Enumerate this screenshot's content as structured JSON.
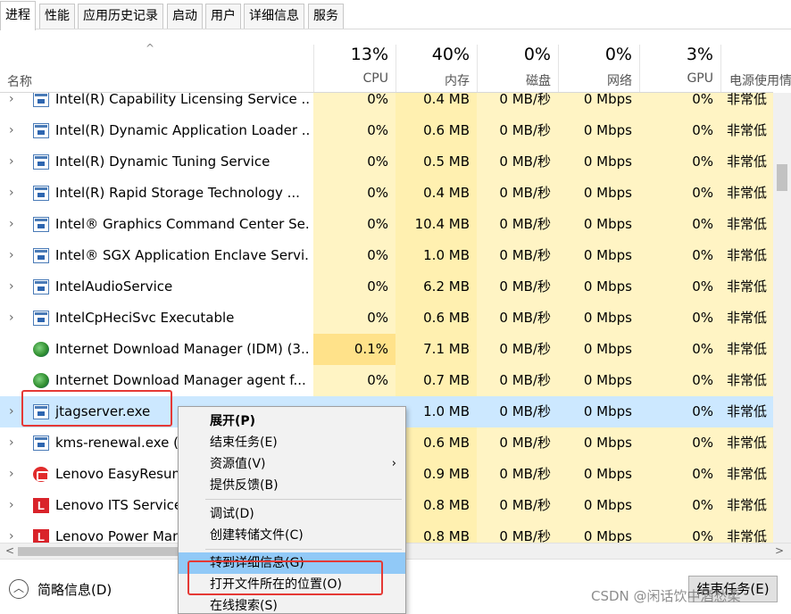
{
  "tabs": [
    {
      "label": "进程",
      "active": true
    },
    {
      "label": "性能",
      "active": false
    },
    {
      "label": "应用历史记录",
      "active": false
    },
    {
      "label": "启动",
      "active": false
    },
    {
      "label": "用户",
      "active": false
    },
    {
      "label": "详细信息",
      "active": false
    },
    {
      "label": "服务",
      "active": false
    }
  ],
  "header": {
    "sort_glyph": "^",
    "name_label": "名称",
    "cpu": {
      "pct": "13%",
      "label": "CPU"
    },
    "mem": {
      "pct": "40%",
      "label": "内存"
    },
    "disk": {
      "pct": "0%",
      "label": "磁盘"
    },
    "net": {
      "pct": "0%",
      "label": "网络"
    },
    "gpu": {
      "pct": "3%",
      "label": "GPU"
    },
    "power_label": "电源使用情"
  },
  "rows": [
    {
      "name": "Intel(R) Capability Licensing Service ...",
      "cpu": "0%",
      "mem": "0.4 MB",
      "disk": "0 MB/秒",
      "net": "0 Mbps",
      "gpu": "0%",
      "power": "非常低",
      "icon": "service-icon",
      "expandable": true
    },
    {
      "name": "Intel(R) Dynamic Application Loader ...",
      "cpu": "0%",
      "mem": "0.6 MB",
      "disk": "0 MB/秒",
      "net": "0 Mbps",
      "gpu": "0%",
      "power": "非常低",
      "icon": "service-icon",
      "expandable": true
    },
    {
      "name": "Intel(R) Dynamic Tuning Service",
      "cpu": "0%",
      "mem": "0.5 MB",
      "disk": "0 MB/秒",
      "net": "0 Mbps",
      "gpu": "0%",
      "power": "非常低",
      "icon": "service-icon",
      "expandable": true
    },
    {
      "name": "Intel(R) Rapid Storage Technology ...",
      "cpu": "0%",
      "mem": "0.4 MB",
      "disk": "0 MB/秒",
      "net": "0 Mbps",
      "gpu": "0%",
      "power": "非常低",
      "icon": "service-icon",
      "expandable": true
    },
    {
      "name": "Intel® Graphics Command Center Se...",
      "cpu": "0%",
      "mem": "10.4 MB",
      "disk": "0 MB/秒",
      "net": "0 Mbps",
      "gpu": "0%",
      "power": "非常低",
      "icon": "service-icon",
      "expandable": true
    },
    {
      "name": "Intel® SGX Application Enclave Servi...",
      "cpu": "0%",
      "mem": "1.0 MB",
      "disk": "0 MB/秒",
      "net": "0 Mbps",
      "gpu": "0%",
      "power": "非常低",
      "icon": "service-icon",
      "expandable": true
    },
    {
      "name": "IntelAudioService",
      "cpu": "0%",
      "mem": "6.2 MB",
      "disk": "0 MB/秒",
      "net": "0 Mbps",
      "gpu": "0%",
      "power": "非常低",
      "icon": "service-icon",
      "expandable": true
    },
    {
      "name": "IntelCpHeciSvc Executable",
      "cpu": "0%",
      "mem": "0.6 MB",
      "disk": "0 MB/秒",
      "net": "0 Mbps",
      "gpu": "0%",
      "power": "非常低",
      "icon": "service-icon",
      "expandable": true
    },
    {
      "name": "Internet Download Manager (IDM) (3...",
      "cpu": "0.1%",
      "mem": "7.1 MB",
      "disk": "0 MB/秒",
      "net": "0 Mbps",
      "gpu": "0%",
      "power": "非常低",
      "icon": "idm-globe-icon",
      "expandable": false
    },
    {
      "name": "Internet Download Manager agent f...",
      "cpu": "0%",
      "mem": "0.7 MB",
      "disk": "0 MB/秒",
      "net": "0 Mbps",
      "gpu": "0%",
      "power": "非常低",
      "icon": "idm-globe-icon",
      "expandable": false
    },
    {
      "name": "jtagserver.exe",
      "cpu": "0%",
      "mem": "1.0 MB",
      "disk": "0 MB/秒",
      "net": "0 Mbps",
      "gpu": "0%",
      "power": "非常低",
      "icon": "service-icon",
      "expandable": true,
      "selected": true
    },
    {
      "name": "kms-renewal.exe (3",
      "cpu": "",
      "mem": "0.6 MB",
      "disk": "0 MB/秒",
      "net": "0 Mbps",
      "gpu": "0%",
      "power": "非常低",
      "icon": "service-icon",
      "expandable": true
    },
    {
      "name": "Lenovo EasyResum",
      "cpu": "",
      "mem": "0.9 MB",
      "disk": "0 MB/秒",
      "net": "0 Mbps",
      "gpu": "0%",
      "power": "非常低",
      "icon": "lenovo-easyresume-icon",
      "expandable": true
    },
    {
      "name": "Lenovo ITS Service",
      "cpu": "",
      "mem": "0.8 MB",
      "disk": "0 MB/秒",
      "net": "0 Mbps",
      "gpu": "0%",
      "power": "非常低",
      "icon": "lenovo-l-icon",
      "expandable": true
    },
    {
      "name": "Lenovo Power Man",
      "cpu": "",
      "mem": "0.8 MB",
      "disk": "0 MB/秒",
      "net": "0 Mbps",
      "gpu": "0%",
      "power": "非常低",
      "icon": "lenovo-l-icon",
      "expandable": true
    }
  ],
  "context_menu": {
    "items": [
      {
        "label": "展开(P)",
        "bold": true
      },
      {
        "label": "结束任务(E)"
      },
      {
        "label": "资源值(V)",
        "submenu": true
      },
      {
        "label": "提供反馈(B)"
      },
      {
        "separator": true
      },
      {
        "label": "调试(D)"
      },
      {
        "label": "创建转储文件(C)"
      },
      {
        "separator": true
      },
      {
        "label": "转到详细信息(G)",
        "hover": true
      },
      {
        "label": "打开文件所在的位置(O)"
      },
      {
        "label": "在线搜索(S)"
      }
    ]
  },
  "footer": {
    "brief_label": "简略信息(D)",
    "end_task_label": "结束任务(E)",
    "watermark": "CSDN @闲话饮中酒愁柔"
  },
  "colors": {
    "selection": "#cce8ff",
    "heat_light": "#fff4c4",
    "heat_mid": "#fff0b0",
    "heat_hot": "#ffe28a",
    "menu_hover": "#91c9f7",
    "highlight_box": "#e53935"
  }
}
